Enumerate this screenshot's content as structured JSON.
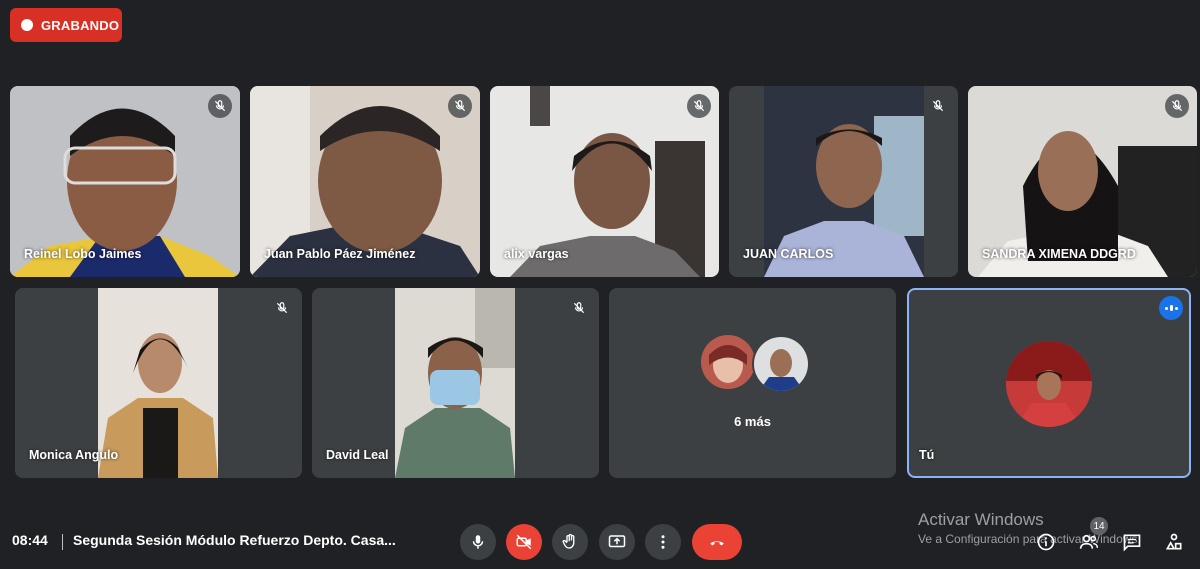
{
  "recording": {
    "label": "GRABANDO"
  },
  "participants": [
    {
      "name": "Reinel Lobo Jaimes"
    },
    {
      "name": "Juan Pablo Páez Jiménez"
    },
    {
      "name": "alix vargas"
    },
    {
      "name": "JUAN CARLOS"
    },
    {
      "name": "SANDRA XIMENA DDGRD"
    },
    {
      "name": "Monica Angulo"
    },
    {
      "name": "David Leal"
    }
  ],
  "more": {
    "label": "6 más"
  },
  "self": {
    "label": "Tú"
  },
  "footer": {
    "time": "08:44",
    "title": "Segunda Sesión Módulo Refuerzo Depto. Casa...",
    "participants_count": "14"
  },
  "watermark": {
    "line1": "Activar Windows",
    "line2": "Ve a Configuración para activar Windows."
  },
  "colors": {
    "accent": "#1a73e8",
    "danger": "#ea4335",
    "surface": "#3c4043",
    "background": "#202124"
  },
  "icons": {
    "mute": "mic-off-icon",
    "mic": "mic-icon",
    "camera_off": "videocam-off-icon",
    "hand": "raise-hand-icon",
    "present": "present-screen-icon",
    "more": "more-vert-icon",
    "end": "call-end-icon",
    "info": "info-icon",
    "people": "people-icon",
    "chat": "chat-icon",
    "activities": "activities-icon"
  }
}
